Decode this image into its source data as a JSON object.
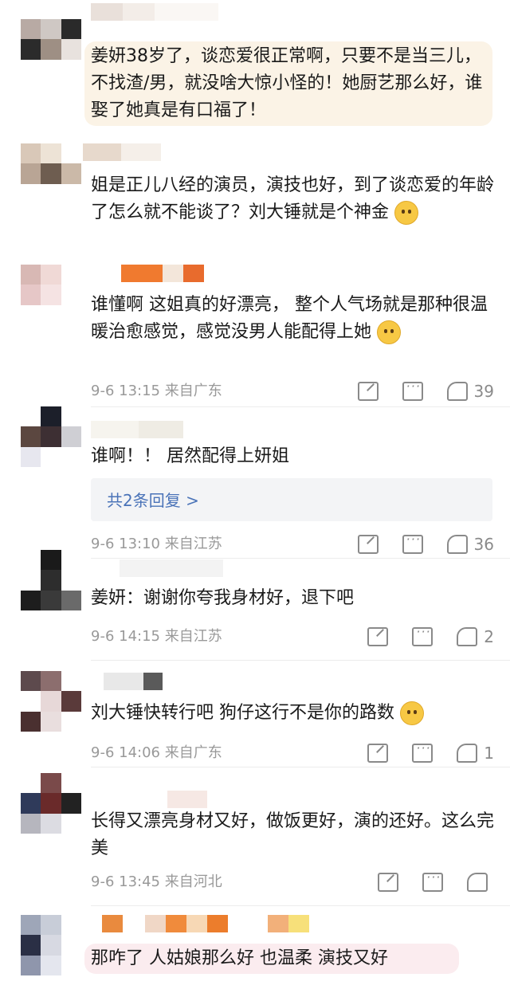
{
  "comments": [
    {
      "text": "姜妍38岁了，谈恋爱很正常啊，只要不是当三儿，不找渣/男，就没啥大惊小怪的！她厨艺那么好，谁娶了她真是有口福了！",
      "avatar_colors": [
        "#b8aaa4",
        "#cfc8c4",
        "#2a2a2a",
        "#2b2b2b",
        "#9e8f84",
        "#e8e2de",
        "#ffffff",
        "#ffffff",
        "#ffffff"
      ]
    },
    {
      "text": "姐是正儿八经的演员，演技也好，到了谈恋爱的年龄了怎么就不能谈了？刘大锤就是个神金",
      "emoji": "smile-emoji",
      "avatar_colors": [
        "#d9c8b8",
        "#ede3d6",
        "#ffffff",
        "#b9a595",
        "#6e5d50",
        "#cbb9a8",
        "#ffffff",
        "#ffffff",
        "#ffffff"
      ]
    },
    {
      "text": "谁懂啊 这姐真的好漂亮， 整个人气场就是那种很温暖治愈感觉，感觉没男人能配得上她",
      "emoji": "laugh-cry-emoji",
      "date": "9-6 13:15",
      "location": "来自广东",
      "likes": "39",
      "avatar_colors": [
        "#d8b8b4",
        "#f0d9d6",
        "#ffffff",
        "#e6c7c7",
        "#f5e3e3",
        "#ffffff",
        "#ffffff",
        "#ffffff",
        "#ffffff"
      ]
    },
    {
      "text": "谁啊！！ 居然配得上妍姐",
      "reply_link": "共2条回复 >",
      "date": "9-6 13:10",
      "location": "来自江苏",
      "likes": "36",
      "avatar_colors": [
        "#ffffff",
        "#1c1f2a",
        "#ffffff",
        "#5b4740",
        "#3d2f33",
        "#cfcfd4",
        "#e7e7ef",
        "#ffffff",
        "#ffffff"
      ]
    },
    {
      "text": "姜妍：谢谢你夸我身材好，退下吧",
      "date": "9-6 14:15",
      "location": "来自江苏",
      "likes": "2",
      "avatar_colors": [
        "#ffffff",
        "#1a1a1a",
        "#ffffff",
        "#ffffff",
        "#2d2d2d",
        "#ffffff",
        "#1d1d1d",
        "#3a3a3a",
        "#6a6a6a"
      ]
    },
    {
      "text": "刘大锤快转行吧 狗仔这行不是你的路数",
      "emoji": "sad-emoji",
      "date": "9-6 14:06",
      "location": "来自广东",
      "likes": "1",
      "avatar_colors": [
        "#5d4a4d",
        "#8c6e6e",
        "#ffffff",
        "#ffffff",
        "#e7d8d8",
        "#5a3a3a",
        "#4a3030",
        "#e9dede",
        "#ffffff"
      ]
    },
    {
      "text": "长得又漂亮身材又好，做饭更好，演的还好。这么完美",
      "date": "9-6 13:45",
      "location": "来自河北",
      "likes": "",
      "avatar_colors": [
        "#ffffff",
        "#7a4a4a",
        "#ffffff",
        "#2f3a5a",
        "#6a2a2a",
        "#222222",
        "#b6b6be",
        "#dcdce2",
        "#ffffff"
      ]
    },
    {
      "text": "那咋了 人姑娘那么好 也温柔 演技又好",
      "avatar_colors": [
        "#9ea6b8",
        "#c8cdd8",
        "#ffffff",
        "#2a2f45",
        "#d7d9e2",
        "#ffffff",
        "#8f96ac",
        "#e4e6ee",
        "#ffffff"
      ]
    }
  ],
  "icons": {
    "share": "share-icon",
    "comment": "comment-icon",
    "like": "like-icon"
  }
}
